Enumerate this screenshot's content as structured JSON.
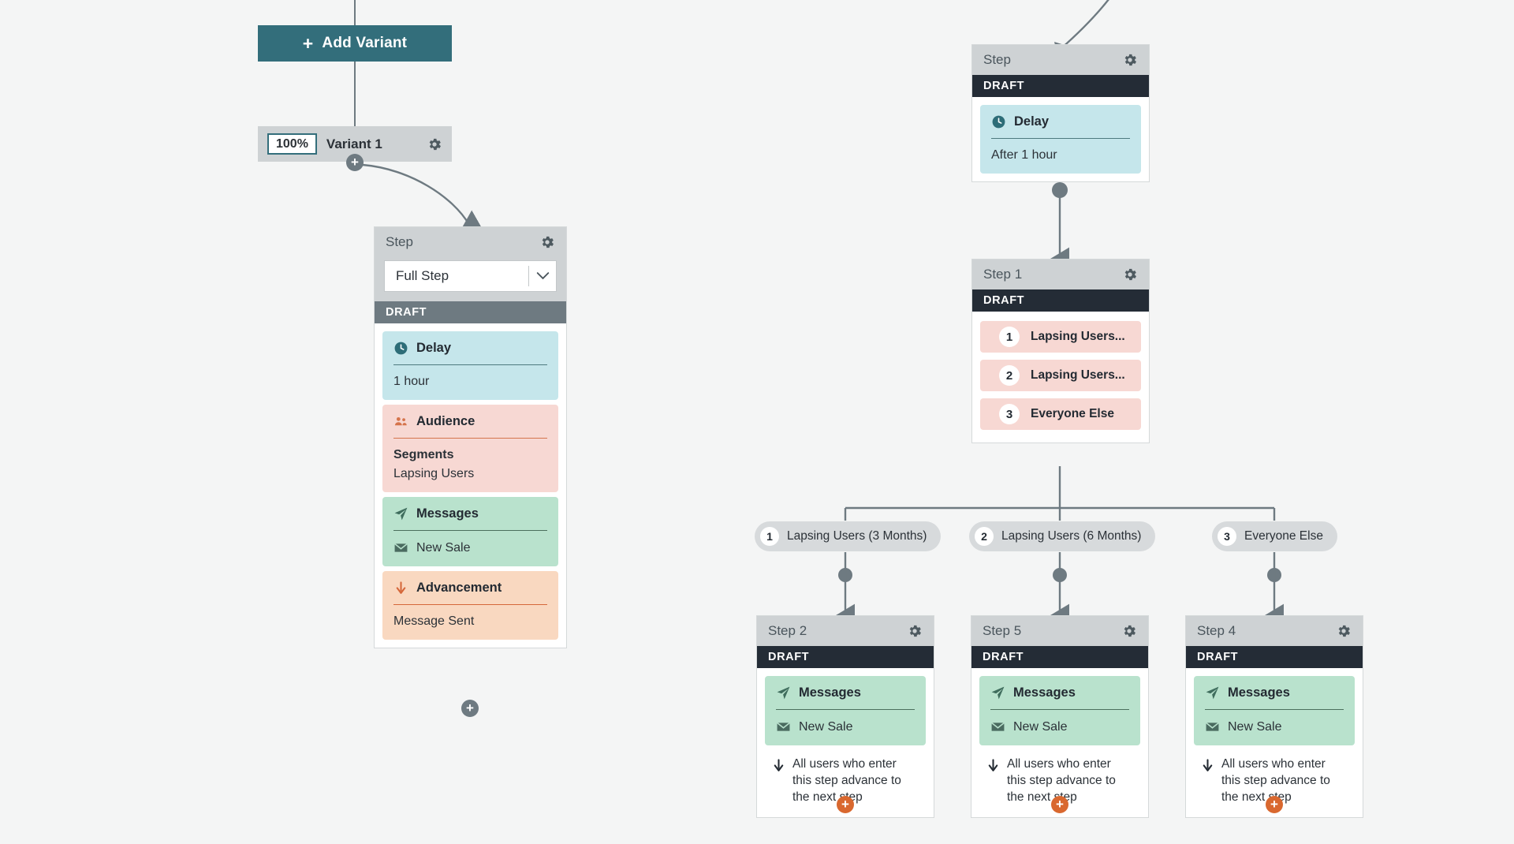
{
  "colors": {
    "background": "#f4f5f5",
    "accent_teal": "#336e7b",
    "card_header": "#ced2d4",
    "draft_dark": "#242c36",
    "draft_gray": "#6e7a81",
    "delay_block": "#c5e6eb",
    "audience_block": "#f7d8d3",
    "messages_block": "#b9e2cd",
    "advancement_block": "#f9d8c0",
    "connector": "#6e7a81",
    "add_button_orange": "#d9682f"
  },
  "toolbar": {
    "add_variant_label": "Add Variant",
    "add_variant_icon": "plus-icon"
  },
  "variant": {
    "percent": "100%",
    "name": "Variant 1",
    "gear_icon": "gear-icon"
  },
  "main_step": {
    "title": "Step",
    "gear_icon": "gear-icon",
    "type_select": {
      "value": "Full Step",
      "chevron_icon": "chevron-down-icon"
    },
    "status": "DRAFT",
    "blocks": [
      {
        "kind": "delay",
        "icon": "clock-icon",
        "heading": "Delay",
        "lines": [
          "1 hour"
        ]
      },
      {
        "kind": "audience",
        "icon": "people-icon",
        "heading": "Audience",
        "label": "Segments",
        "lines": [
          "Lapsing Users"
        ]
      },
      {
        "kind": "messages",
        "icon": "paper-plane-icon",
        "heading": "Messages",
        "items": [
          {
            "icon": "envelope-icon",
            "label": "New Sale"
          }
        ]
      },
      {
        "kind": "advancement",
        "icon": "arrow-down-icon",
        "heading": "Advancement",
        "lines": [
          "Message Sent"
        ]
      }
    ],
    "add_icon": "plus-circle-icon"
  },
  "delay_step": {
    "title": "Step",
    "gear_icon": "gear-icon",
    "status": "DRAFT",
    "block": {
      "icon": "clock-icon",
      "heading": "Delay",
      "line": "After 1 hour"
    }
  },
  "split_step": {
    "title": "Step 1",
    "gear_icon": "gear-icon",
    "status": "DRAFT",
    "branches": [
      {
        "num": "1",
        "label": "Lapsing Users..."
      },
      {
        "num": "2",
        "label": "Lapsing Users..."
      },
      {
        "num": "3",
        "label": "Everyone Else"
      }
    ]
  },
  "branch_pills": [
    {
      "num": "1",
      "label": "Lapsing Users (3 Months)"
    },
    {
      "num": "2",
      "label": "Lapsing Users (6 Months)"
    },
    {
      "num": "3",
      "label": "Everyone Else"
    }
  ],
  "leaf_steps": [
    {
      "title": "Step 2",
      "gear_icon": "gear-icon",
      "status": "DRAFT",
      "messages_heading": "Messages",
      "messages_icon": "paper-plane-icon",
      "message_item_icon": "envelope-icon",
      "message_item": "New Sale",
      "advance_icon": "arrow-down-icon",
      "advance_note": "All users who enter this step advance to the next step",
      "add_icon": "plus-circle-icon"
    },
    {
      "title": "Step 5",
      "gear_icon": "gear-icon",
      "status": "DRAFT",
      "messages_heading": "Messages",
      "messages_icon": "paper-plane-icon",
      "message_item_icon": "envelope-icon",
      "message_item": "New Sale",
      "advance_icon": "arrow-down-icon",
      "advance_note": "All users who enter this step advance to the next step",
      "add_icon": "plus-circle-icon"
    },
    {
      "title": "Step 4",
      "gear_icon": "gear-icon",
      "status": "DRAFT",
      "messages_heading": "Messages",
      "messages_icon": "paper-plane-icon",
      "message_item_icon": "envelope-icon",
      "message_item": "New Sale",
      "advance_icon": "arrow-down-icon",
      "advance_note": "All users who enter this step advance to the next step",
      "add_icon": "plus-circle-icon"
    }
  ]
}
